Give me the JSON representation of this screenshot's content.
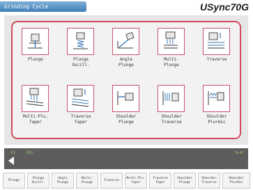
{
  "window": {
    "title": "Grinding Cycle",
    "brand": "USync70G"
  },
  "grid": {
    "row1": [
      {
        "label": "Plunge",
        "icon": "plunge-icon"
      },
      {
        "label": "Plunge\nOscill.",
        "icon": "plunge-oscill-icon"
      },
      {
        "label": "Angle\nPlunge",
        "icon": "angle-plunge-icon"
      },
      {
        "label": "Multi-\nPlunge",
        "icon": "multi-plunge-icon"
      },
      {
        "label": "Traverse",
        "icon": "traverse-icon"
      }
    ],
    "row2": [
      {
        "label": "Multi-Plu.\nTaper",
        "icon": "multi-plu-taper-icon"
      },
      {
        "label": "Traverse\nTaper",
        "icon": "traverse-taper-icon"
      },
      {
        "label": "Shoulder\nPlunge",
        "icon": "shoulder-plunge-icon"
      },
      {
        "label": "Shoulder\nTraverse",
        "icon": "shoulder-traverse-icon"
      },
      {
        "label": "Shoulder\nPlu+Osc",
        "icon": "shoulder-plu-osc-icon"
      }
    ]
  },
  "status": {
    "left": "01",
    "mid": "001",
    "right": "Ts-47"
  },
  "softkeys": [
    "Plunge",
    "Plunge\nOscill.",
    "Angle\nPlunge",
    "Multi-\nPlunge",
    "Traverse",
    "Multi-Plu.\nTaper",
    "Traverse\nTaper",
    "Shoulder\nPlunge",
    "Shoulder\nTraverse",
    "Shoulder\nPlu+Osc"
  ],
  "colors": {
    "accent": "#d04a5a",
    "title_bg": "#3f7fb5",
    "status_bg": "#5d5d5d",
    "status_text": "#9bd06a"
  }
}
